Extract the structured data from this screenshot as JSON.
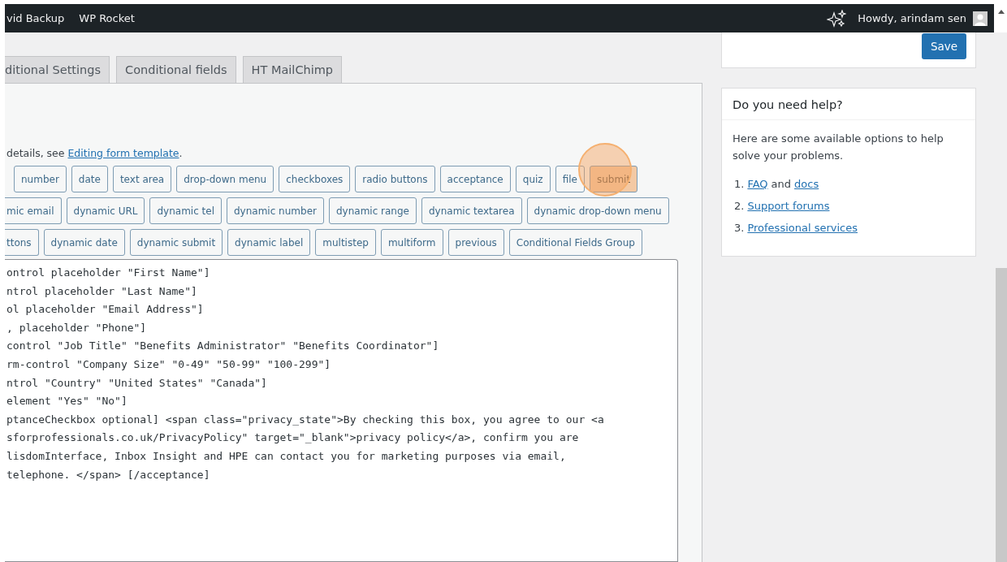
{
  "admin_bar": {
    "items": [
      "vid Backup",
      "WP Rocket"
    ],
    "greeting": "Howdy, arindam sen"
  },
  "tabs": [
    {
      "label": "ditional Settings",
      "selected": false
    },
    {
      "label": "Conditional fields",
      "selected": false
    },
    {
      "label": "HT MailChimp",
      "selected": false
    }
  ],
  "editor": {
    "intro": "details, see ",
    "intro_link": "Editing form template",
    "intro_end": ".",
    "tag_rows": [
      [
        {
          "label": "number",
          "highlighted": false
        },
        {
          "label": "date",
          "highlighted": false
        },
        {
          "label": "text area",
          "highlighted": false
        },
        {
          "label": "drop-down menu",
          "highlighted": false
        },
        {
          "label": "checkboxes",
          "highlighted": false
        },
        {
          "label": "radio buttons",
          "highlighted": false
        },
        {
          "label": "acceptance",
          "highlighted": false
        },
        {
          "label": "quiz",
          "highlighted": false
        },
        {
          "label": "file",
          "highlighted": false
        },
        {
          "label": "submit",
          "highlighted": true
        }
      ],
      [
        {
          "label": "mic email",
          "highlighted": false
        },
        {
          "label": "dynamic URL",
          "highlighted": false
        },
        {
          "label": "dynamic tel",
          "highlighted": false
        },
        {
          "label": "dynamic number",
          "highlighted": false
        },
        {
          "label": "dynamic range",
          "highlighted": false
        },
        {
          "label": "dynamic textarea",
          "highlighted": false
        },
        {
          "label": "dynamic drop-down menu",
          "highlighted": false
        }
      ],
      [
        {
          "label": "ttons",
          "highlighted": false
        },
        {
          "label": "dynamic date",
          "highlighted": false
        },
        {
          "label": "dynamic submit",
          "highlighted": false
        },
        {
          "label": "dynamic label",
          "highlighted": false
        },
        {
          "label": "multistep",
          "highlighted": false
        },
        {
          "label": "multiform",
          "highlighted": false
        },
        {
          "label": "previous",
          "highlighted": false
        },
        {
          "label": "Conditional Fields Group",
          "highlighted": false
        }
      ]
    ],
    "code_lines": [
      "ontrol placeholder \"First Name\"]",
      "ntrol placeholder \"Last Name\"]",
      "ol placeholder \"Email Address\"]",
      ", placeholder \"Phone\"]",
      "control \"Job Title\" \"Benefits Administrator\" \"Benefits Coordinator\"]",
      "rm-control \"Company Size\" \"0-49\" \"50-99\" \"100-299\"]",
      "ntrol \"Country\" \"United States\" \"Canada\"]",
      "element \"Yes\" \"No\"]",
      "ptanceCheckbox optional] <span class=\"privacy_state\">By checking this box, you agree to our <a",
      "sforprofessionals.co.uk/PrivacyPolicy\" target=\"_blank\">privacy policy</a>, confirm you are",
      "lisdomInterface, Inbox Insight and HPE can contact you for marketing purposes via email,",
      "telephone. </span> [/acceptance]"
    ]
  },
  "save_box": {
    "button": "Save"
  },
  "help": {
    "title": "Do you need help?",
    "text": "Here are some available options to help solve your problems.",
    "items": [
      {
        "number": "1.",
        "parts": [
          {
            "text": "FAQ",
            "link": true
          },
          {
            "text": "and",
            "link": false
          },
          {
            "text": "docs",
            "link": true
          }
        ]
      },
      {
        "number": "2.",
        "parts": [
          {
            "text": "Support forums",
            "link": true
          }
        ]
      },
      {
        "number": "3.",
        "parts": [
          {
            "text": "Professional services",
            "link": true
          }
        ]
      }
    ]
  }
}
